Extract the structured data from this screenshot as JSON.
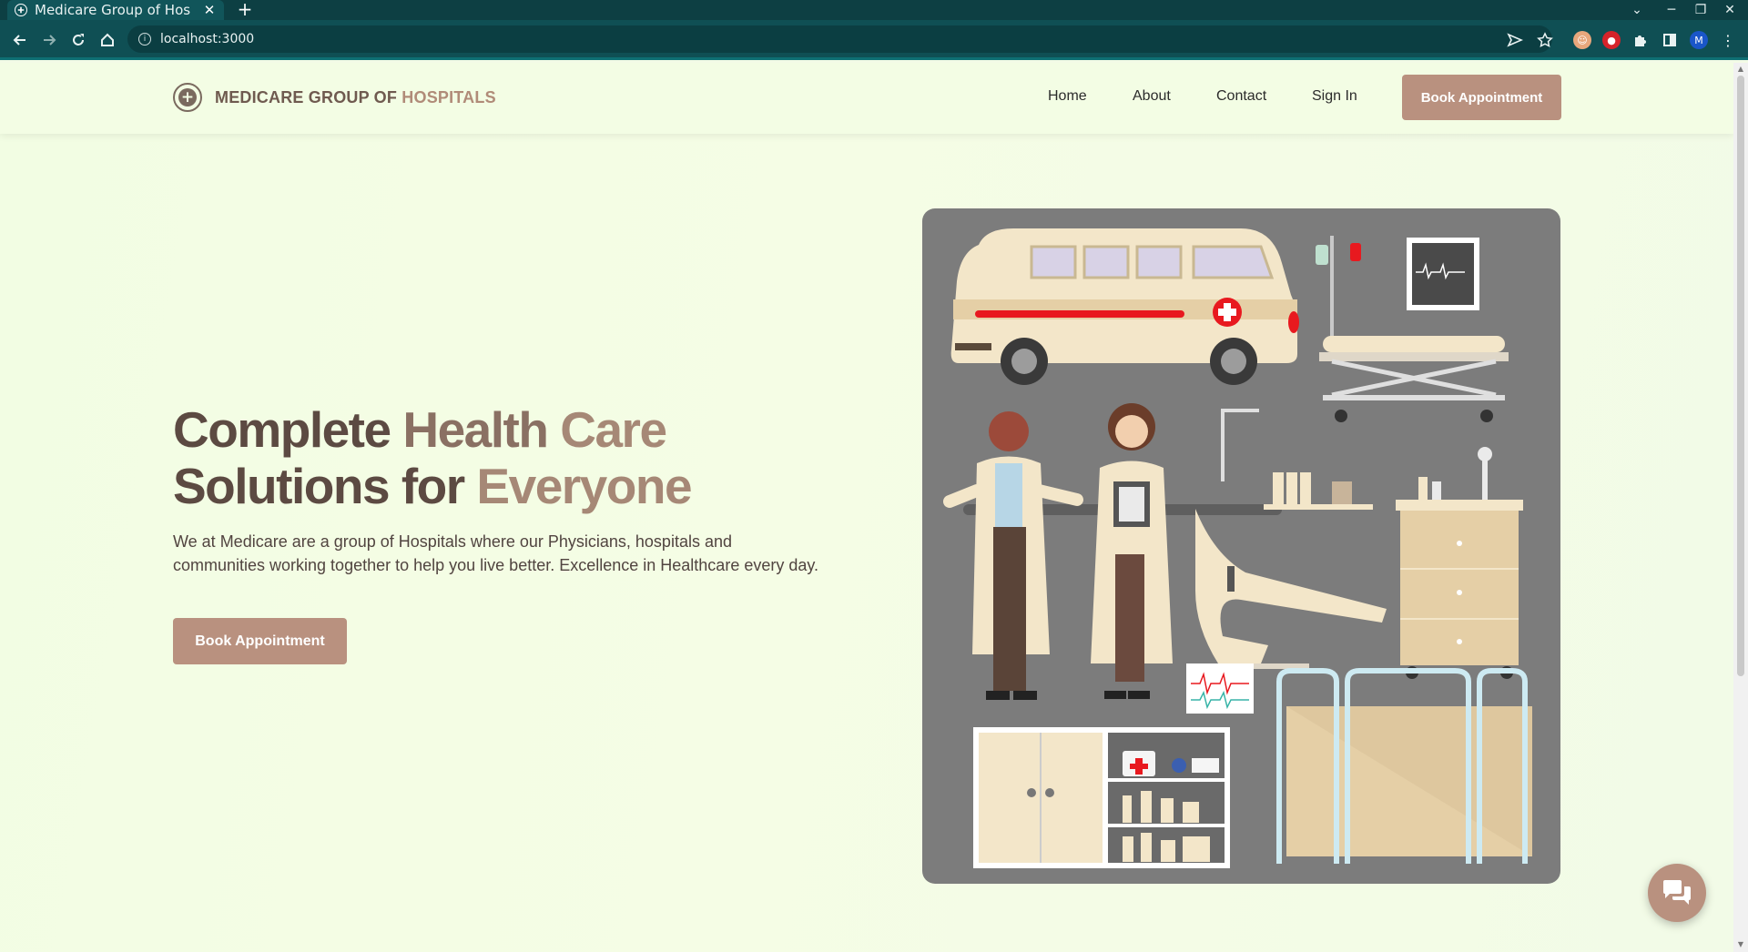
{
  "browser": {
    "tab_title": "Medicare Group of Hospitals",
    "url": "localhost:3000",
    "profile_initial": "M"
  },
  "nav": {
    "brand_part1": "MEDICARE GROUP OF",
    "brand_part2": "HOSPITALS",
    "links": [
      "Home",
      "About",
      "Contact",
      "Sign In"
    ],
    "cta": "Book Appointment"
  },
  "hero": {
    "title_line1_a": "Complete",
    "title_line1_b": "Health",
    "title_line1_c": "Care",
    "title_line2_a": "Solutions for",
    "title_line2_b": "Everyone",
    "description": "We at Medicare are a group of Hospitals where our Physicians, hospitals and communities working together to help you live better. Excellence in Healthcare every day.",
    "cta": "Book Appointment"
  },
  "colors": {
    "accent": "#b9917f",
    "brand_dark": "#6f5a4f",
    "page_bg": "#f3fde4",
    "browser_chrome": "#0f4f54"
  },
  "icons": {
    "brand": "medical-cross-icon",
    "chat": "chat-bubbles-icon"
  }
}
